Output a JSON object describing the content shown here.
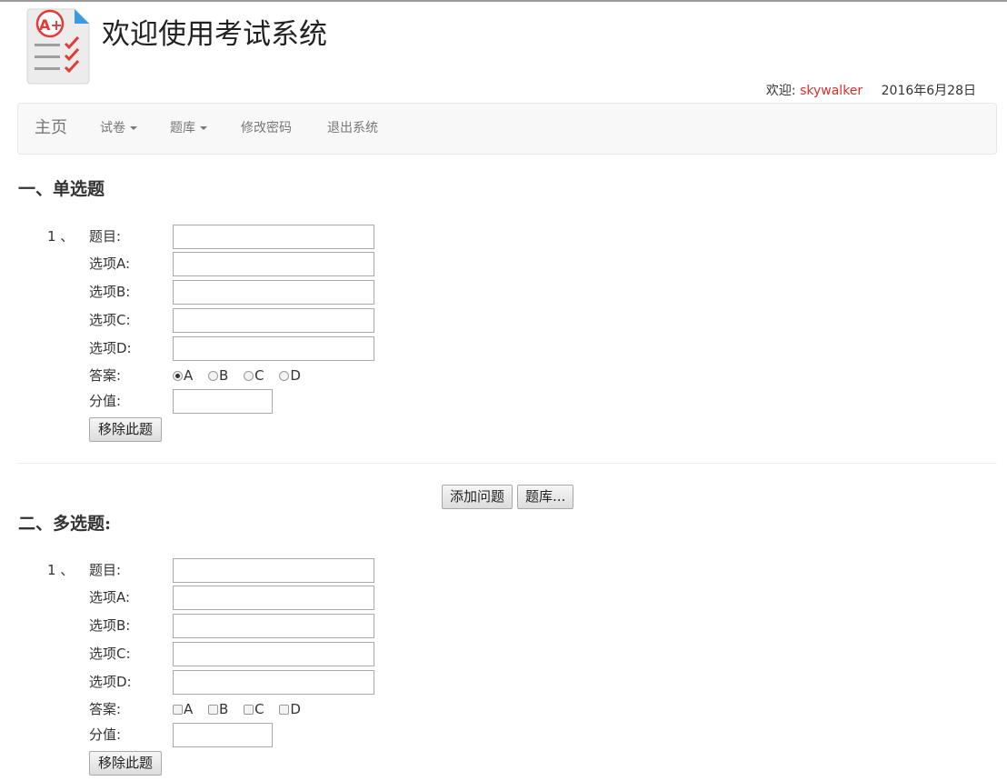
{
  "header": {
    "title": "欢迎使用考试系统",
    "welcome_label": "欢迎:",
    "username": "skywalker",
    "date": "2016年6月28日",
    "logo_icon": "exam-checklist-icon",
    "colors": {
      "username": "#d9302c",
      "logo_accent": "#e53935",
      "logo_corner": "#3b9ae1"
    }
  },
  "nav": {
    "brand": "主页",
    "items": [
      {
        "label": "试卷",
        "dropdown": true
      },
      {
        "label": "题库",
        "dropdown": true
      },
      {
        "label": "修改密码",
        "dropdown": false
      },
      {
        "label": "退出系统",
        "dropdown": false
      }
    ]
  },
  "single": {
    "section_title": "一、单选题",
    "question_number": "1 、",
    "labels": {
      "question": "题目:",
      "a": "选项A:",
      "b": "选项B:",
      "c": "选项C:",
      "d": "选项D:",
      "answer": "答案:",
      "score": "分值:"
    },
    "answer_options": [
      "A",
      "B",
      "C",
      "D"
    ],
    "selected_answer": "A",
    "values": {
      "question": "",
      "a": "",
      "b": "",
      "c": "",
      "d": "",
      "score": ""
    },
    "remove_label": "移除此题"
  },
  "actions": {
    "add_question": "添加问题",
    "question_bank": "题库..."
  },
  "multi": {
    "section_title": "二、多选题:",
    "question_number": "1 、",
    "labels": {
      "question": "题目:",
      "a": "选项A:",
      "b": "选项B:",
      "c": "选项C:",
      "d": "选项D:",
      "answer": "答案:",
      "score": "分值:"
    },
    "answer_options": [
      "A",
      "B",
      "C",
      "D"
    ],
    "values": {
      "question": "",
      "a": "",
      "b": "",
      "c": "",
      "d": "",
      "score": ""
    },
    "remove_label": "移除此题"
  }
}
